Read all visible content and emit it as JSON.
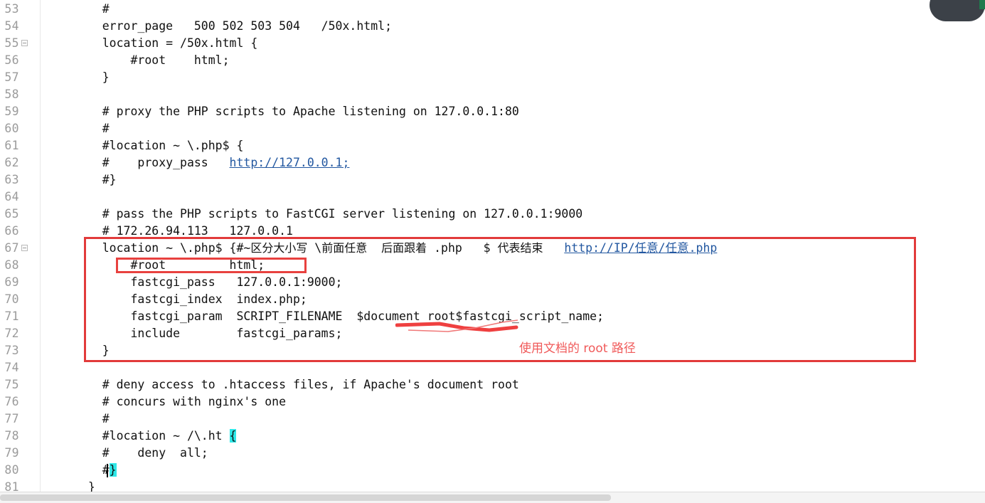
{
  "editor": {
    "kind": "text-editor-nginx-config",
    "first_line_number": 53,
    "line_height_px": 24,
    "colors": {
      "background": "#ffffff",
      "text": "#111111",
      "gutter_text": "#9b9b9b",
      "link": "#2257a0",
      "annotation_red": "#e23b3b",
      "annotation_note_red": "#f05a5a",
      "brace_match_highlight": "#2ee8e8"
    },
    "gutter": {
      "line_numbers": [
        "53",
        "54",
        "55",
        "56",
        "57",
        "58",
        "59",
        "60",
        "61",
        "62",
        "63",
        "64",
        "65",
        "66",
        "67",
        "68",
        "69",
        "70",
        "71",
        "72",
        "73",
        "74",
        "75",
        "76",
        "77",
        "78",
        "79",
        "80",
        "81"
      ],
      "fold_markers_on_lines": [
        "55",
        "67"
      ],
      "fold_marker_icon": "collapse-box-icon"
    },
    "lines": [
      {
        "n": "53",
        "segments": [
          {
            "text": "    #"
          }
        ]
      },
      {
        "n": "54",
        "segments": [
          {
            "text": "    error_page   500 502 503 504   /50x.html;"
          }
        ]
      },
      {
        "n": "55",
        "segments": [
          {
            "text": "    location = /50x.html {"
          }
        ]
      },
      {
        "n": "56",
        "segments": [
          {
            "text": "        #root    html;"
          }
        ]
      },
      {
        "n": "57",
        "segments": [
          {
            "text": "    }"
          }
        ]
      },
      {
        "n": "58",
        "segments": [
          {
            "text": ""
          }
        ]
      },
      {
        "n": "59",
        "segments": [
          {
            "text": "    # proxy the PHP scripts to Apache listening on 127.0.0.1:80"
          }
        ]
      },
      {
        "n": "60",
        "segments": [
          {
            "text": "    #"
          }
        ]
      },
      {
        "n": "61",
        "segments": [
          {
            "text": "    #location ~ \\.php$ {"
          }
        ]
      },
      {
        "n": "62",
        "segments": [
          {
            "text": "    #    proxy_pass   "
          },
          {
            "text": "http://127.0.0.1;",
            "style": "link"
          }
        ]
      },
      {
        "n": "63",
        "segments": [
          {
            "text": "    #}"
          }
        ]
      },
      {
        "n": "64",
        "segments": [
          {
            "text": ""
          }
        ]
      },
      {
        "n": "65",
        "segments": [
          {
            "text": "    # pass the PHP scripts to FastCGI server listening on 127.0.0.1:9000"
          }
        ]
      },
      {
        "n": "66",
        "segments": [
          {
            "text": "    # 172.26.94.113   127.0.0.1"
          }
        ]
      },
      {
        "n": "67",
        "segments": [
          {
            "text": "    location ~ \\.php$ {#~"
          },
          {
            "text": "区分大小写",
            "style": "cn"
          },
          {
            "text": " \\"
          },
          {
            "text": "前面任意",
            "style": "cn"
          },
          {
            "text": "  "
          },
          {
            "text": "后面跟着",
            "style": "cn"
          },
          {
            "text": " .php   $ "
          },
          {
            "text": "代表结束",
            "style": "cn"
          },
          {
            "text": "   "
          },
          {
            "text": "http://IP/任意/任意.php",
            "style": "link"
          }
        ]
      },
      {
        "n": "68",
        "segments": [
          {
            "text": "        #root         html;"
          }
        ]
      },
      {
        "n": "69",
        "segments": [
          {
            "text": "        fastcgi_pass   127.0.0.1:9000;"
          }
        ]
      },
      {
        "n": "70",
        "segments": [
          {
            "text": "        fastcgi_index  index.php;"
          }
        ]
      },
      {
        "n": "71",
        "segments": [
          {
            "text": "        fastcgi_param  SCRIPT_FILENAME  $document_root$fastcgi_script_name;"
          }
        ]
      },
      {
        "n": "72",
        "segments": [
          {
            "text": "        include        fastcgi_params;"
          }
        ]
      },
      {
        "n": "73",
        "segments": [
          {
            "text": "    }"
          }
        ]
      },
      {
        "n": "74",
        "segments": [
          {
            "text": ""
          }
        ]
      },
      {
        "n": "75",
        "segments": [
          {
            "text": "    # deny access to .htaccess files, if Apache's document root"
          }
        ]
      },
      {
        "n": "76",
        "segments": [
          {
            "text": "    # concurs with nginx's one"
          }
        ]
      },
      {
        "n": "77",
        "segments": [
          {
            "text": "    #"
          }
        ]
      },
      {
        "n": "78",
        "segments": [
          {
            "text": "    #location ~ /\\.ht "
          },
          {
            "text": "{",
            "style": "brace-hl"
          }
        ]
      },
      {
        "n": "79",
        "segments": [
          {
            "text": "    #    deny  all;"
          }
        ]
      },
      {
        "n": "80",
        "segments": [
          {
            "text": "    #"
          },
          {
            "text": "}",
            "style": "brace-hl"
          }
        ]
      },
      {
        "n": "81",
        "segments": [
          {
            "text": "  }"
          }
        ]
      }
    ],
    "annotations": {
      "outer_rectangle_label": "red-rectangle-around-php-location-block",
      "inner_rectangle_label": "red-rectangle-around-root-html",
      "underline_label": "red-hand-underline-on-document-root",
      "note_text": "使用文档的 root 路径"
    },
    "caret": {
      "after_line": "80",
      "label": "text-cursor"
    },
    "scrollbar": {
      "orientation": "horizontal",
      "thumb_ratio": 0.62
    }
  }
}
